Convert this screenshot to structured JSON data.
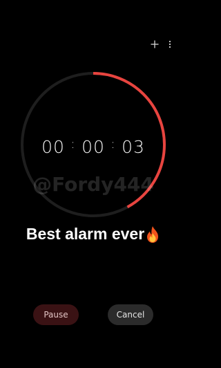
{
  "toolbar": {
    "add_icon": "plus-icon",
    "more_icon": "more-vertical-icon"
  },
  "timer": {
    "hours": "00",
    "minutes": "00",
    "seconds": "03",
    "separator": ":",
    "progress_fraction": 0.42,
    "ring_track_color": "#1e1e1e",
    "ring_progress_color": "#e8443f"
  },
  "overlay": {
    "watermark": "@Fordy444",
    "caption": "Best alarm ever",
    "caption_icon": "fire-icon"
  },
  "controls": {
    "pause_label": "Pause",
    "cancel_label": "Cancel"
  }
}
